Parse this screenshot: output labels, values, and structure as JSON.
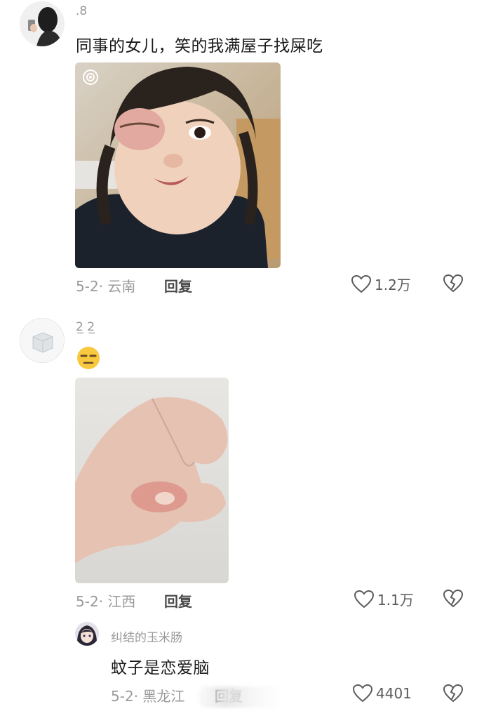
{
  "comments": [
    {
      "username": ".8",
      "text": "同事的女儿，笑的我满屋子找屎吃",
      "date_location": "5-2· 云南",
      "reply_label": "回复",
      "likes": "1.2万",
      "avatar_icon": "woman-selfie-avatar",
      "photo_icon": "girl-swollen-eye-photo"
    },
    {
      "username": "2̲ 2̲",
      "emoji": "😑",
      "date_location": "5-2· 江西",
      "reply_label": "回复",
      "likes": "1.1万",
      "avatar_icon": "ice-cube-avatar",
      "photo_icon": "swollen-hand-photo"
    },
    {
      "username": "纠结的玉米肠",
      "text": "蚊子是恋爱脑",
      "date_location": "5-2· 黑龙江",
      "reply_label": "回复",
      "likes": "4401",
      "avatar_icon": "anime-girl-avatar"
    }
  ],
  "colors": {
    "text": "#1a1a1a",
    "meta": "#9a9a9a",
    "icon": "#5a5a5a"
  }
}
